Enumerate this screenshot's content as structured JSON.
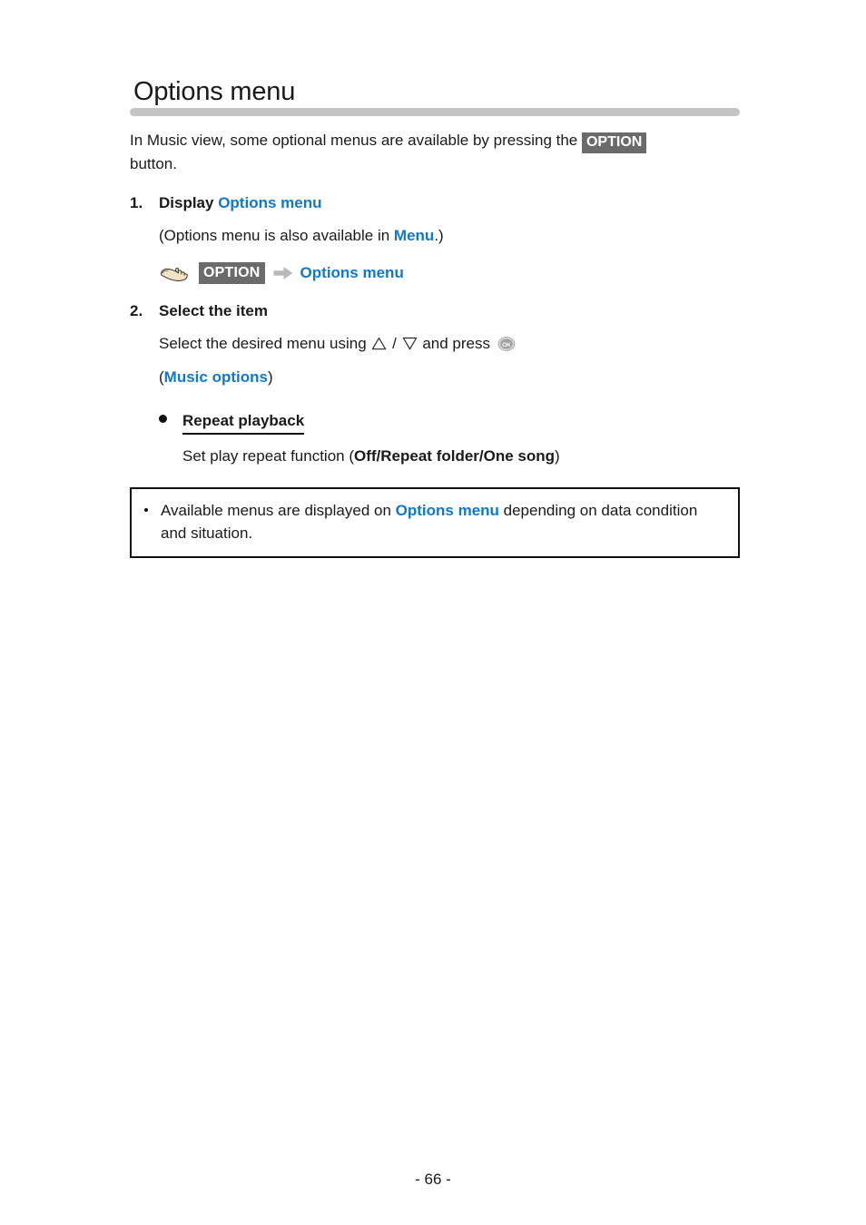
{
  "document": {
    "title": "Options menu",
    "footer_page_label": "- 66 -"
  },
  "intro": {
    "text_before_key": "In Music view, some optional menus are available by pressing the ",
    "key_label": "OPTION",
    "text_after_key": "button."
  },
  "steps": [
    {
      "number": "1.",
      "heading_plain": "Display ",
      "heading_link": "Options menu",
      "note_before": "(Options menu is also available in ",
      "note_link": "Menu",
      "note_after": ".)",
      "operation": {
        "hand_icon": "pointing-hand-icon",
        "key_label": "OPTION",
        "arrow_icon": "arrow-right-icon",
        "target_label": "Options menu"
      }
    },
    {
      "number": "2.",
      "heading_plain": "Select the item",
      "instruction_before": "Select the desired menu using ",
      "up_icon": "triangle-up-icon",
      "instruction_separator": " / ",
      "down_icon": "triangle-down-icon",
      "instruction_after": " and press ",
      "ok_icon": "ok-button-icon",
      "reference_open": "(",
      "reference_link": "Music options",
      "reference_close": ")"
    }
  ],
  "option_item": {
    "bullet_icon": "filled-circle-bullet",
    "label": "Repeat playback",
    "description_before": "Set play repeat function (",
    "values": "Off/Repeat folder/One song",
    "description_after": ")"
  },
  "note": {
    "bullet_icon": "small-bullet",
    "text_before_link": "Available menus are displayed on ",
    "link": "Options menu",
    "text_after_link": " depending on data condition and situation."
  },
  "colors": {
    "link_blue": "#1178c8",
    "key_badge_gray": "#6b6b6b",
    "title_rule_gray": "#c4c4c4",
    "text_black": "#1a1a1a"
  }
}
